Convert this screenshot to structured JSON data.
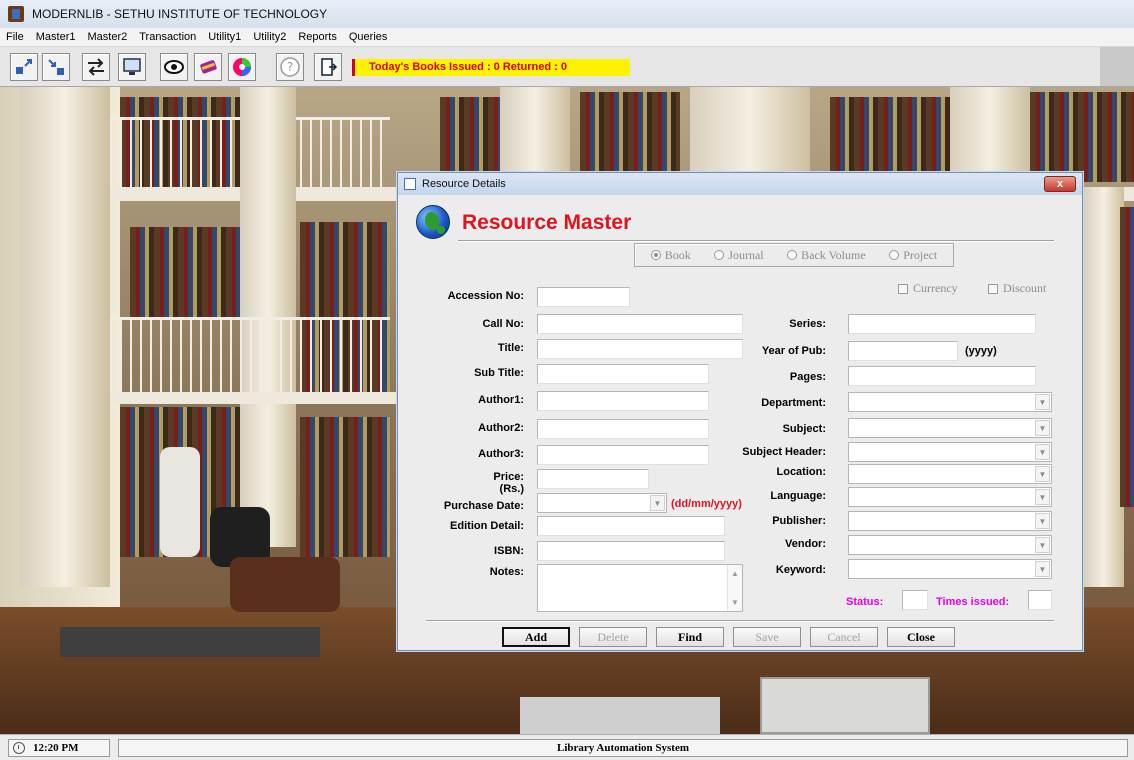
{
  "window": {
    "title": "MODERNLIB - SETHU INSTITUTE OF TECHNOLOGY"
  },
  "menu": [
    "File",
    "Master1",
    "Master2",
    "Transaction",
    "Utility1",
    "Utility2",
    "Reports",
    "Queries"
  ],
  "toolbar": {
    "icons": [
      "expand-icon",
      "shrink-icon",
      "transfer-icon",
      "monitor-icon",
      "eye-icon",
      "books-icon",
      "cd-icon",
      "help-icon",
      "exit-door-icon"
    ],
    "banner": "Today's Books Issued : 0 Returned : 0"
  },
  "dialog": {
    "title": "Resource Details",
    "close_label": "x",
    "heading": "Resource Master",
    "resource_types": [
      {
        "label": "Book",
        "selected": true
      },
      {
        "label": "Journal",
        "selected": false
      },
      {
        "label": "Back Volume",
        "selected": false
      },
      {
        "label": "Project",
        "selected": false
      }
    ],
    "checkboxes": {
      "currency": "Currency",
      "discount": "Discount"
    },
    "left_fields": {
      "accession_no": {
        "label": "Accession No:",
        "value": ""
      },
      "call_no": {
        "label": "Call No:",
        "value": ""
      },
      "title": {
        "label": "Title:",
        "value": ""
      },
      "sub_title": {
        "label": "Sub Title:",
        "value": ""
      },
      "author1": {
        "label": "Author1:",
        "value": ""
      },
      "author2": {
        "label": "Author2:",
        "value": ""
      },
      "author3": {
        "label": "Author3:",
        "value": ""
      },
      "price": {
        "label": "Price: (Rs.)",
        "value": ""
      },
      "purchase_date": {
        "label": "Purchase Date:",
        "value": "",
        "hint": "(dd/mm/yyyy)"
      },
      "edition_detail": {
        "label": "Edition Detail:",
        "value": ""
      },
      "isbn": {
        "label": "ISBN:",
        "value": ""
      },
      "notes": {
        "label": "Notes:",
        "value": ""
      }
    },
    "right_fields": {
      "series": {
        "label": "Series:",
        "value": ""
      },
      "year_of_pub": {
        "label": "Year of Pub:",
        "value": "",
        "hint": "(yyyy)"
      },
      "pages": {
        "label": "Pages:",
        "value": ""
      },
      "department": {
        "label": "Department:",
        "value": ""
      },
      "subject": {
        "label": "Subject:",
        "value": ""
      },
      "subject_header": {
        "label": "Subject Header:",
        "value": ""
      },
      "location": {
        "label": "Location:",
        "value": ""
      },
      "language": {
        "label": "Language:",
        "value": ""
      },
      "publisher": {
        "label": "Publisher:",
        "value": ""
      },
      "vendor": {
        "label": "Vendor:",
        "value": ""
      },
      "keyword": {
        "label": "Keyword:",
        "value": ""
      }
    },
    "status": {
      "label": "Status:",
      "value": ""
    },
    "times_issued": {
      "label": "Times issued:",
      "value": ""
    },
    "buttons": {
      "add": "Add",
      "delete": "Delete",
      "find": "Find",
      "save": "Save",
      "cancel": "Cancel",
      "close": "Close"
    },
    "colors": {
      "heading": "#e0141e",
      "hint_red": "#e0141e",
      "status_magenta": "#e600e6"
    }
  },
  "statusbar": {
    "time": "12:20 PM",
    "app_name": "Library Automation System"
  }
}
